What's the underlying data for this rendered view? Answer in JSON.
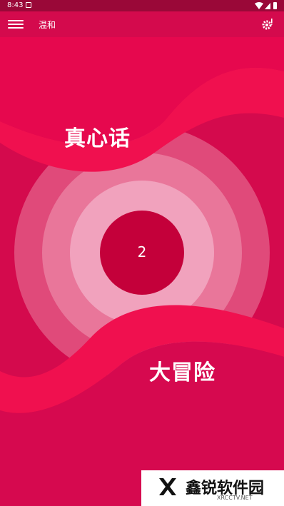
{
  "status_bar": {
    "time": "8:43"
  },
  "toolbar": {
    "title": "温和",
    "menu_icon": "hamburger-icon",
    "settings_icon": "gear-icon"
  },
  "wheel": {
    "top_label": "真心话",
    "bottom_label": "大冒险",
    "center_value": "2"
  },
  "watermark": {
    "brand": "鑫锐软件园",
    "url": "XRCCTV.NET"
  },
  "colors": {
    "primary": "#d40a4d",
    "accent": "#f0104f",
    "status_bar": "#9a0838",
    "center_circle": "#c4003a"
  }
}
